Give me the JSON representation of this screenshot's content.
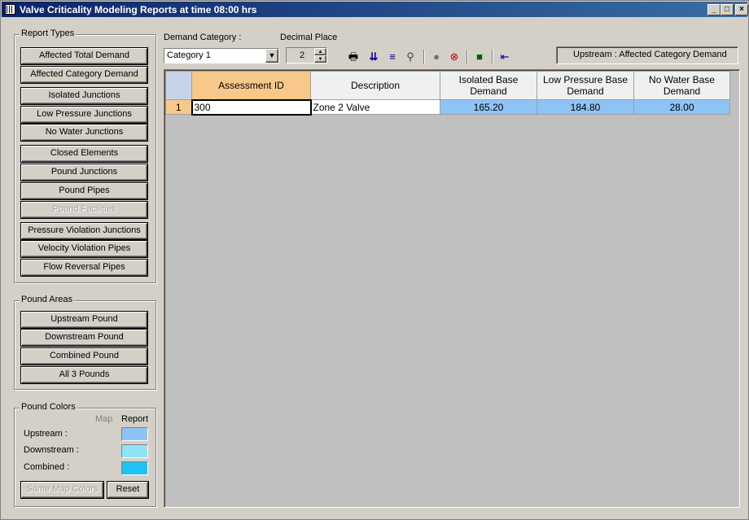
{
  "window": {
    "title": "Valve Criticality Modeling Reports at time 08:00 hrs",
    "minimize_glyph": "_",
    "maximize_glyph": "□",
    "close_glyph": "×"
  },
  "report_types": {
    "legend": "Report Types",
    "buttons": [
      {
        "label": "Affected Total Demand",
        "enabled": true
      },
      {
        "label": "Affected Category Demand",
        "enabled": true
      },
      {
        "label": "Isolated Junctions",
        "enabled": true
      },
      {
        "label": "Low Pressure Junctions",
        "enabled": true
      },
      {
        "label": "No Water Junctions",
        "enabled": true
      },
      {
        "label": "Closed Elements",
        "enabled": true
      },
      {
        "label": "Pound Junctions",
        "enabled": true
      },
      {
        "label": "Pound Pipes",
        "enabled": true
      },
      {
        "label": "Pound Facilities",
        "enabled": false
      },
      {
        "label": "Pressure Violation Junctions",
        "enabled": true
      },
      {
        "label": "Velocity Violation Pipes",
        "enabled": true
      },
      {
        "label": "Flow Reversal Pipes",
        "enabled": true
      }
    ]
  },
  "pound_areas": {
    "legend": "Pound Areas",
    "buttons": [
      {
        "label": "Upstream Pound"
      },
      {
        "label": "Downstream Pound"
      },
      {
        "label": "Combined Pound"
      },
      {
        "label": "All 3 Pounds"
      }
    ]
  },
  "pound_colors": {
    "legend": "Pound Colors",
    "col_map": "Map",
    "col_report": "Report",
    "rows": [
      {
        "label": "Upstream :",
        "color": "#8ec3f5"
      },
      {
        "label": "Downstream :",
        "color": "#8fe3f7"
      },
      {
        "label": "Combined :",
        "color": "#1ec3f5"
      }
    ],
    "same_map_colors": "Same Map Colors",
    "reset": "Reset"
  },
  "toolbar": {
    "demand_category_label": "Demand Category :",
    "demand_category_value": "Category 1",
    "decimal_place_label": "Decimal Place",
    "decimal_place_value": "2",
    "status_text": "Upstream : Affected Category Demand",
    "icons": [
      "print-icon",
      "sort-ascending-icon",
      "filter-icon",
      "find-icon",
      "locate-icon",
      "clear-highlight-icon",
      "save-icon",
      "exit-icon"
    ]
  },
  "grid": {
    "columns": [
      "Assessment ID",
      "Description",
      "Isolated Base\nDemand",
      "Low Pressure Base\nDemand",
      "No Water Base\nDemand"
    ],
    "rows": [
      {
        "num": "1",
        "assessment_id": "300",
        "description": "Zone 2  Valve",
        "isolated": "165.20",
        "low_pressure": "184.80",
        "no_water": "28.00"
      }
    ],
    "highlight_color": "#8ec3f5",
    "header_selected_color": "#f7c88a"
  }
}
